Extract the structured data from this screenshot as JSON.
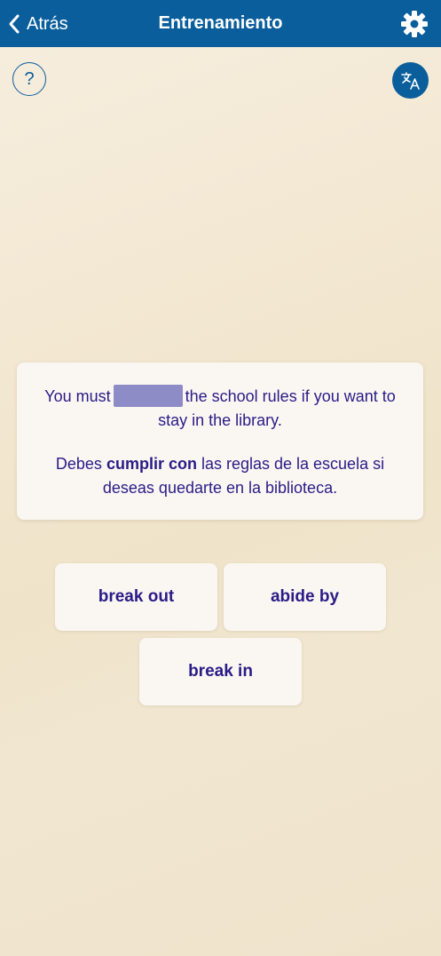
{
  "header": {
    "back_label": "Atrás",
    "title": "Entrenamiento",
    "settings_icon": "gear-icon",
    "back_icon": "chevron-left-icon"
  },
  "controls": {
    "help_label": "?",
    "translate_icon": "translate-icon"
  },
  "exercise": {
    "sentence_before": "You must",
    "sentence_after": "the school rules if you want to stay in the library.",
    "translation_before": "Debes",
    "translation_highlight": "cumplir con",
    "translation_after": "las reglas de la escuela si deseas quedarte en la biblioteca."
  },
  "options": [
    {
      "label": "break out"
    },
    {
      "label": "abide by"
    },
    {
      "label": "break in"
    }
  ],
  "colors": {
    "header_bg": "#0b5e9c",
    "text_accent": "#2a1b86",
    "blank_fill": "#8e8cc6",
    "card_bg": "#faf7f3"
  }
}
